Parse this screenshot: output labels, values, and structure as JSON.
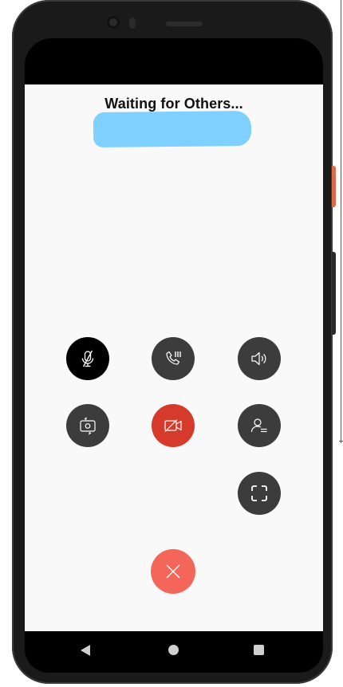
{
  "call": {
    "status_title": "Waiting for Others..."
  },
  "controls": [
    {
      "name": "mute-microphone-button",
      "icon": "microphone-muted-icon"
    },
    {
      "name": "call-hold-button",
      "icon": "phone-hold-icon"
    },
    {
      "name": "speaker-button",
      "icon": "speaker-icon"
    },
    {
      "name": "switch-camera-button",
      "icon": "switch-camera-icon"
    },
    {
      "name": "video-off-button",
      "icon": "video-off-icon"
    },
    {
      "name": "participants-button",
      "icon": "participant-list-icon"
    },
    {
      "name": "fullscreen-button",
      "icon": "fullscreen-icon"
    },
    {
      "name": "end-call-button",
      "icon": "close-icon"
    }
  ],
  "colors": {
    "screen_bg": "#f9f9f9",
    "control_bg": "#3c3c3c",
    "mute_bg": "#000000",
    "video_off_bg": "#d63a2a",
    "end_call_bg": "#f4665a",
    "redaction": "#7fd0ff"
  }
}
